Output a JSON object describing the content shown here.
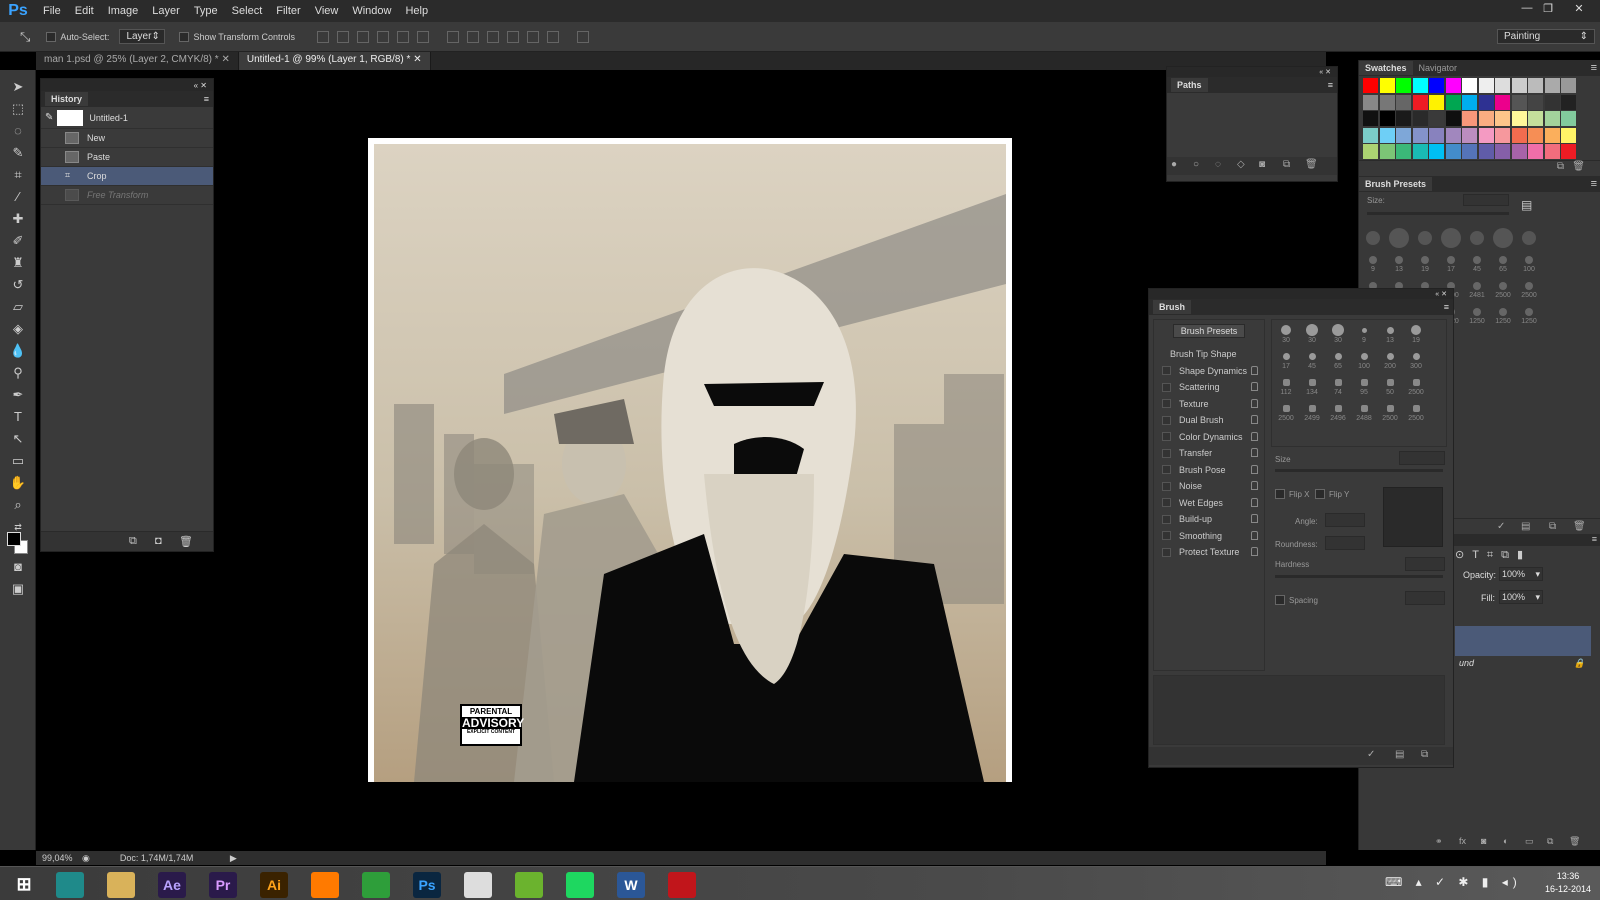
{
  "app": {
    "logo": "Ps"
  },
  "menu": [
    "File",
    "Edit",
    "Image",
    "Layer",
    "Type",
    "Select",
    "Filter",
    "View",
    "Window",
    "Help"
  ],
  "options_bar": {
    "auto_select_label": "Auto-Select:",
    "auto_select_value": "Layer",
    "show_transform_label": "Show Transform Controls",
    "workspace": "Painting"
  },
  "tabs": [
    {
      "label": "man 1.psd @ 25% (Layer 2, CMYK/8) *",
      "active": false
    },
    {
      "label": "Untitled-1 @ 99% (Layer 1, RGB/8) *",
      "active": true
    }
  ],
  "history": {
    "title": "History",
    "snapshot": "Untitled-1",
    "items": [
      {
        "label": "New",
        "state": "normal"
      },
      {
        "label": "Paste",
        "state": "normal"
      },
      {
        "label": "Crop",
        "state": "selected"
      },
      {
        "label": "Free Transform",
        "state": "dimmed"
      }
    ]
  },
  "paths": {
    "title": "Paths"
  },
  "swatches": {
    "tabs": [
      "Swatches",
      "Navigator"
    ],
    "rows": [
      [
        "#ff0000",
        "#ffff00",
        "#00ff00",
        "#00ffff",
        "#0000ff",
        "#ff00ff",
        "#ffffff",
        "#eeeeee",
        "#dddddd",
        "#cccccc",
        "#bbbbbb",
        "#aaaaaa",
        "#999999"
      ],
      [
        "#888888",
        "#777777",
        "#666666",
        "#ee1c24",
        "#fff200",
        "#00a651",
        "#00aeef",
        "#2e3192",
        "#ec008c",
        "#555555",
        "#444444",
        "#333333",
        "#222222"
      ],
      [
        "#111111",
        "#000000",
        "#1a1a1a",
        "#2a2a2a",
        "#3a3a3a",
        "#0f0f0f",
        "#f7977a",
        "#f9ad81",
        "#fdc68a",
        "#fff79a",
        "#c4df9b",
        "#a3d39c",
        "#82ca9d"
      ],
      [
        "#7bcdc8",
        "#6ecff6",
        "#7ea7d8",
        "#8493ca",
        "#8882be",
        "#a187be",
        "#bc8dbf",
        "#f49ac2",
        "#f6989d",
        "#f26c4f",
        "#f68e55",
        "#fbaf5c",
        "#fff467"
      ],
      [
        "#acd372",
        "#7cc576",
        "#3bb878",
        "#1abbb4",
        "#00bff3",
        "#438cca",
        "#5574b9",
        "#605ca8",
        "#855fa8",
        "#a763a8",
        "#f06ea9",
        "#f26d7d",
        "#ed1c24"
      ]
    ]
  },
  "brush_presets_panel": {
    "title": "Brush Presets",
    "size_label": "Size:"
  },
  "brush_panel": {
    "title": "Brush",
    "presets_button": "Brush Presets",
    "tip_shape": "Brush Tip Shape",
    "options": [
      "Shape Dynamics",
      "Scattering",
      "Texture",
      "Dual Brush",
      "Color Dynamics",
      "Transfer",
      "Brush Pose",
      "Noise",
      "Wet Edges",
      "Build-up",
      "Smoothing",
      "Protect Texture"
    ],
    "tips_row1": [
      "30",
      "30",
      "30",
      "9",
      "13",
      "19"
    ],
    "tips_row2": [
      "17",
      "45",
      "65",
      "100",
      "200",
      "300"
    ],
    "tips_row3": [
      "112",
      "134",
      "74",
      "95",
      "50",
      "2500"
    ],
    "tips_row4": [
      "2500",
      "2499",
      "2496",
      "2488",
      "2500",
      "2500"
    ],
    "size_label": "Size",
    "flipx": "Flip X",
    "flipy": "Flip Y",
    "angle_label": "Angle:",
    "roundness_label": "Roundness:",
    "hardness_label": "Hardness",
    "spacing_label": "Spacing"
  },
  "bg_brush_labels": [
    "9",
    "13",
    "19",
    "17",
    "45",
    "65",
    "100",
    "200",
    "50",
    "2500",
    "2500",
    "2481",
    "2500",
    "2500",
    "40",
    "304",
    "2480",
    "1520",
    "1250",
    "1250",
    "1250",
    "1250",
    "1250",
    "1250"
  ],
  "layers": {
    "opacity_label": "Opacity:",
    "opacity": "100%",
    "fill_label": "Fill:",
    "fill": "100%",
    "background_layer": "und"
  },
  "status": {
    "zoom": "99,04%",
    "doc": "Doc: 1,74M/1,74M"
  },
  "artwork": {
    "advisory_line1": "PARENTAL",
    "advisory_line2": "ADVISORY",
    "advisory_line3": "EXPLICIT CONTENT"
  },
  "taskbar": {
    "apps": [
      {
        "label": "",
        "bg": "#1f8a8a",
        "color": "#ffffff"
      },
      {
        "label": "",
        "bg": "#d9b25a",
        "color": "#ffffff"
      },
      {
        "label": "Ae",
        "bg": "#2a1a4a",
        "color": "#b9a3ff"
      },
      {
        "label": "Pr",
        "bg": "#2a1a4a",
        "color": "#d99aff"
      },
      {
        "label": "Ai",
        "bg": "#3a2200",
        "color": "#ffa31a"
      },
      {
        "label": "",
        "bg": "#ff7a00",
        "color": "#ffffff"
      },
      {
        "label": "",
        "bg": "#2e9e3a",
        "color": "#ffffff"
      },
      {
        "label": "Ps",
        "bg": "#0a2640",
        "color": "#3aa3ff"
      },
      {
        "label": "",
        "bg": "#dddddd",
        "color": "#333333"
      },
      {
        "label": "",
        "bg": "#6bb32e",
        "color": "#ffffff"
      },
      {
        "label": "",
        "bg": "#1ed760",
        "color": "#111111"
      },
      {
        "label": "W",
        "bg": "#2b5797",
        "color": "#ffffff"
      },
      {
        "label": "",
        "bg": "#c1151b",
        "color": "#ffffff"
      }
    ],
    "time": "13:36",
    "date": "16-12-2014"
  }
}
